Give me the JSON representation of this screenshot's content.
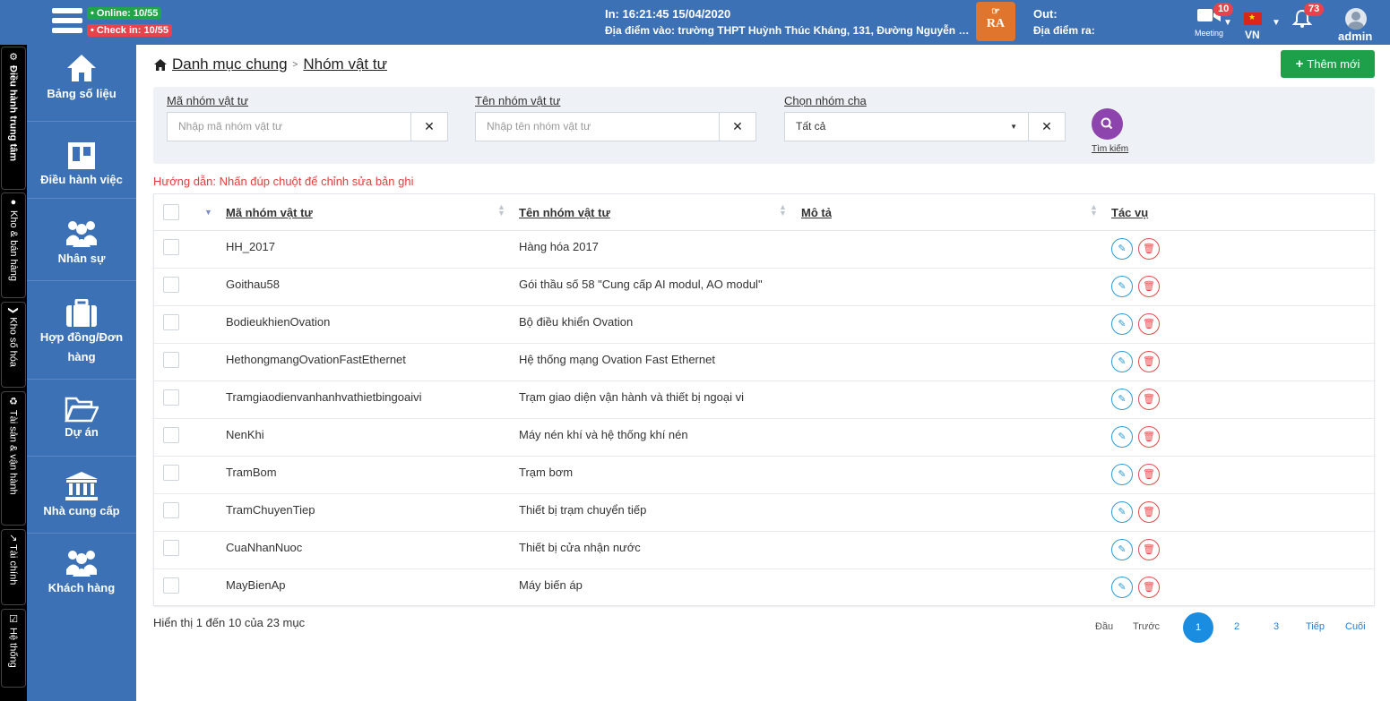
{
  "topbar": {
    "online": "• Online: 10/55",
    "checkin": "• Check in: 10/55",
    "time_in": "In: 16:21:45 15/04/2020",
    "location_in": "Địa điểm vào: trường THPT Huỳnh Thúc Kháng, 131, Đường Nguyễn Tr...",
    "ra_button_top": "☞",
    "ra_button_text": "RA",
    "out_label": "Out:",
    "location_out": "Địa điểm ra:",
    "meeting_label": "Meeting",
    "meeting_count": "10",
    "lang": "VN",
    "notif_count": "73",
    "user": "admin"
  },
  "vtabs": [
    "⚙ Điều hành trung tâm",
    "● Kho & bán hàng",
    "❯ Kho số hóa",
    "♻ Tài sản & vận hành",
    "↗ Tài chính",
    "☑ Hệ thống"
  ],
  "sidebar": [
    "Bảng số liệu",
    "Điều hành việc",
    "Nhân sự",
    "Hợp đồng/Đơn",
    "hàng",
    "Dự án",
    "Nhà cung cấp",
    "Khách hàng"
  ],
  "breadcrumb": {
    "root": "Danh mục chung",
    "sep": ">",
    "current": "Nhóm vật tư"
  },
  "add_button": "Thêm mới",
  "filters": {
    "code_label": "Mã nhóm vật tư",
    "code_placeholder": "Nhập mã nhóm vật tư",
    "name_label": "Tên nhóm vật tư",
    "name_placeholder": "Nhập tên nhóm vật tư",
    "parent_label": "Chọn nhóm cha",
    "parent_value": "Tất cả",
    "search_label": "Tìm kiếm"
  },
  "hint": "Hướng dẫn: Nhấn đúp chuột để chỉnh sửa bản ghi",
  "table": {
    "headers": [
      "Mã nhóm vật tư",
      "Tên nhóm vật tư",
      "Mô tả",
      "Tác vụ"
    ],
    "rows": [
      {
        "code": "HH_2017",
        "name": "Hàng hóa 2017"
      },
      {
        "code": "Goithau58",
        "name": "Gói thầu số 58 \"Cung cấp AI modul, AO modul\""
      },
      {
        "code": "BodieukhienOvation",
        "name": "Bộ điều khiển Ovation"
      },
      {
        "code": "HethongmangOvationFastEthernet",
        "name": "Hệ thống mạng Ovation Fast Ethernet"
      },
      {
        "code": "Tramgiaodienvanhanhvathietbingoaivi",
        "name": "Trạm giao diện vận hành và thiết bị ngoại vi"
      },
      {
        "code": "NenKhi",
        "name": "Máy nén khí và hệ thống khí nén"
      },
      {
        "code": "TramBom",
        "name": "Trạm bơm"
      },
      {
        "code": "TramChuyenTiep",
        "name": "Thiết bị trạm chuyển tiếp"
      },
      {
        "code": "CuaNhanNuoc",
        "name": "Thiết bị cửa nhận nước"
      },
      {
        "code": "MayBienAp",
        "name": "Máy biến áp"
      }
    ]
  },
  "footer": {
    "info": "Hiển thị 1 đến 10 của 23 mục",
    "first": "Đầu",
    "prev": "Trước",
    "pages": [
      "1",
      "2",
      "3"
    ],
    "next": "Tiếp",
    "last": "Cuối"
  },
  "colors": {
    "brand": "#3d71b6",
    "add_button": "#1ea04b",
    "search_button": "#8e44ad",
    "active_page": "#1a8de0"
  }
}
